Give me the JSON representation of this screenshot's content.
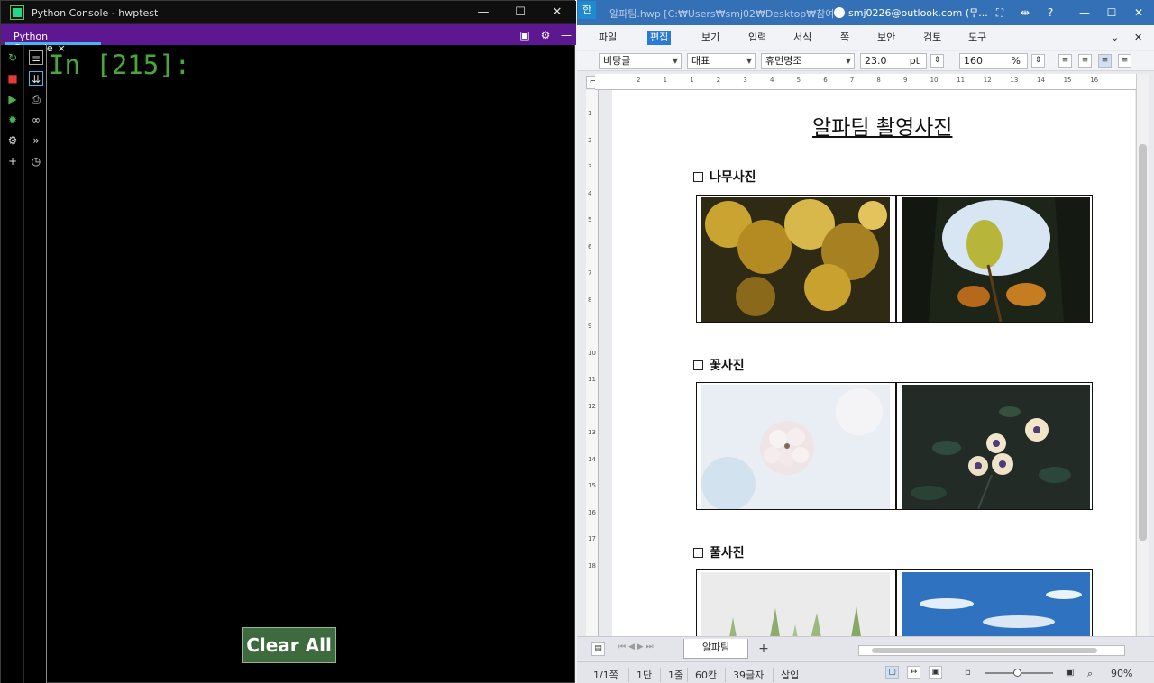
{
  "console_window": {
    "title": "Python Console - hwptest",
    "tab_label": "Python Console",
    "tab_close": "×",
    "prompt": "In [215]:",
    "clear_button": "Clear All",
    "window_controls": {
      "minimize": "—",
      "maximize": "☐",
      "close": "✕"
    }
  },
  "hwp_window": {
    "app_badge": "한",
    "doc_path": "알파팀.hwp [C:₩Users₩smj02₩Desktop₩참여...",
    "account": "smj0226@outlook.com (무...",
    "menu": [
      "파일",
      "편집",
      "보기",
      "입력",
      "서식",
      "쪽",
      "보안",
      "검토",
      "도구"
    ],
    "active_menu": "편집",
    "format_toolbar": {
      "style": "비탕글",
      "lang": "대표",
      "font": "휴먼명조",
      "size": "23.0",
      "unit": "pt",
      "line_spacing": "160",
      "line_spacing_unit": "%"
    },
    "ruler_ticks": [
      "2",
      "1",
      "1",
      "2",
      "3",
      "4",
      "5",
      "6",
      "7",
      "8",
      "9",
      "10",
      "11",
      "12",
      "13",
      "14",
      "15",
      "16"
    ],
    "vruler_ticks": [
      "1",
      "2",
      "3",
      "4",
      "5",
      "6",
      "7",
      "8",
      "9",
      "10",
      "11",
      "12",
      "13",
      "14",
      "15",
      "16",
      "17",
      "18"
    ]
  },
  "document": {
    "title": "알파팀 촬영사진",
    "sections": [
      {
        "heading": "나무사진",
        "photos": [
          "yellow-maple-leaves-photo",
          "single-leaf-against-sky-photo"
        ]
      },
      {
        "heading": "꽃사진",
        "photos": [
          "white-blossom-cluster-photo",
          "daisies-on-dark-background-photo"
        ]
      },
      {
        "heading": "풀사진",
        "photos": [
          "grass-blades-photo",
          "blue-sky-clouds-photo"
        ]
      }
    ]
  },
  "sheet_tabs": {
    "active": "알파팀",
    "add": "+"
  },
  "status_bar": {
    "page": "1/1쪽",
    "column": "1단",
    "line": "1줄",
    "col_pos": "60칸",
    "char_count": "39글자",
    "mode": "삽입",
    "zoom": "90%"
  }
}
